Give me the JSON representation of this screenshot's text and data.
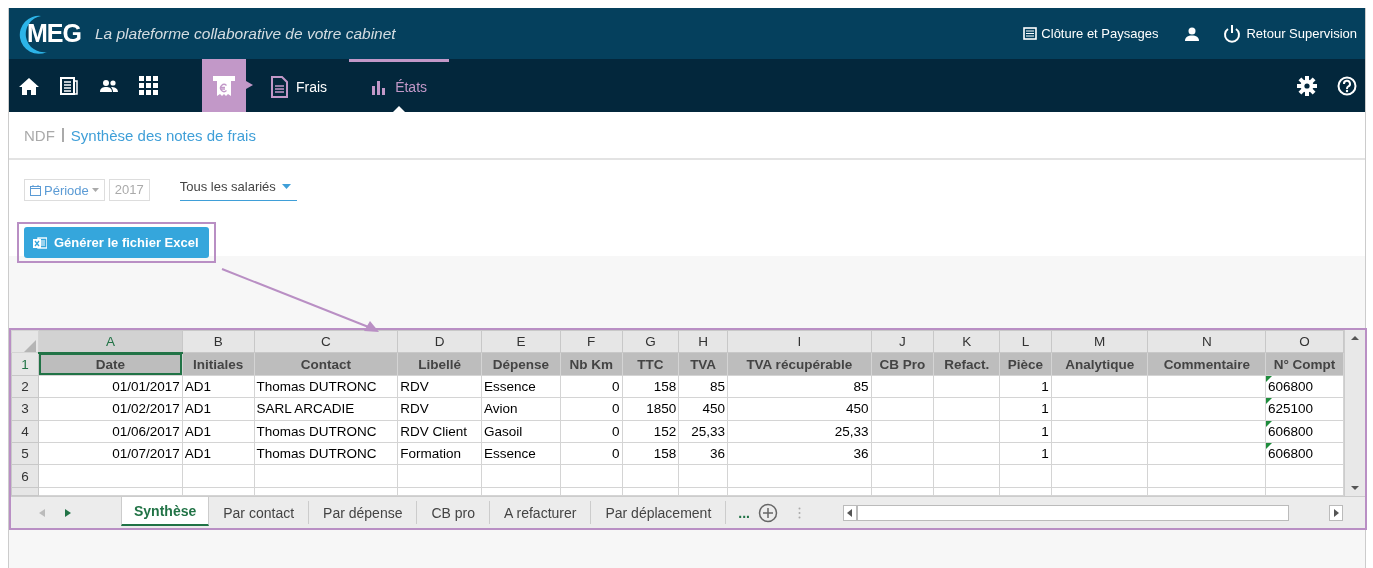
{
  "header": {
    "logo": "MEG",
    "tagline": "La plateforme collaborative de votre cabinet",
    "company": "Clôture et Paysages",
    "logout": "Retour Supervision"
  },
  "nav": {
    "module": {
      "selected": true
    },
    "tabs": [
      {
        "label": "Frais",
        "selected": false
      },
      {
        "label": "États",
        "selected": true
      }
    ]
  },
  "breadcrumb": {
    "root": "NDF",
    "title": "Synthèse des notes de frais"
  },
  "filters": {
    "period": {
      "label": "Période",
      "value": "2017"
    },
    "employee": "Tous les salariés"
  },
  "export_button": {
    "label": "Générer le fichier Excel",
    "highlighted": true
  },
  "spreadsheet": {
    "columns": [
      {
        "letter": "A",
        "header": "Date",
        "kind": "date",
        "selected": true
      },
      {
        "letter": "B",
        "header": "Initiales",
        "kind": "text",
        "selected": false
      },
      {
        "letter": "C",
        "header": "Contact",
        "kind": "text",
        "selected": false
      },
      {
        "letter": "D",
        "header": "Libellé",
        "kind": "text",
        "selected": false
      },
      {
        "letter": "E",
        "header": "Dépense",
        "kind": "text",
        "selected": false
      },
      {
        "letter": "F",
        "header": "Nb Km",
        "kind": "number",
        "selected": false
      },
      {
        "letter": "G",
        "header": "TTC",
        "kind": "number",
        "selected": false
      },
      {
        "letter": "H",
        "header": "TVA",
        "kind": "number",
        "selected": false
      },
      {
        "letter": "I",
        "header": "TVA récupérable",
        "kind": "number",
        "selected": false
      },
      {
        "letter": "J",
        "header": "CB Pro",
        "kind": "text",
        "selected": false
      },
      {
        "letter": "K",
        "header": "Refact.",
        "kind": "text",
        "selected": false
      },
      {
        "letter": "L",
        "header": "Pièce",
        "kind": "number",
        "selected": false
      },
      {
        "letter": "M",
        "header": "Analytique",
        "kind": "text",
        "selected": false
      },
      {
        "letter": "N",
        "header": "Commentaire",
        "kind": "text",
        "selected": false
      },
      {
        "letter": "O",
        "header": "N° Compt",
        "kind": "text_number",
        "selected": false
      }
    ],
    "header_row": "1",
    "rows": [
      {
        "number": "2",
        "cells": [
          "01/01/2017",
          "AD1",
          "Thomas DUTRONC",
          "RDV",
          "Essence",
          "0",
          "158",
          "85",
          "85",
          null,
          null,
          "1",
          null,
          null,
          "606800"
        ]
      },
      {
        "number": "3",
        "cells": [
          "01/02/2017",
          "AD1",
          "SARL ARCADIE",
          "RDV",
          "Avion",
          "0",
          "1850",
          "450",
          "450",
          null,
          null,
          "1",
          null,
          null,
          "625100"
        ]
      },
      {
        "number": "4",
        "cells": [
          "01/06/2017",
          "AD1",
          "Thomas DUTRONC",
          "RDV Client",
          "Gasoil",
          "0",
          "152",
          "25,33",
          "25,33",
          null,
          null,
          "1",
          null,
          null,
          "606800"
        ]
      },
      {
        "number": "5",
        "cells": [
          "01/07/2017",
          "AD1",
          "Thomas DUTRONC",
          "Formation",
          "Essence",
          "0",
          "158",
          "36",
          "36",
          null,
          null,
          "1",
          null,
          null,
          "606800"
        ]
      },
      {
        "number": "6"
      }
    ],
    "sheets": [
      {
        "label": "Synthèse",
        "selected": true
      },
      {
        "label": "Par contact",
        "selected": false
      },
      {
        "label": "Par dépense",
        "selected": false
      },
      {
        "label": "CB pro",
        "selected": false
      },
      {
        "label": "A refacturer",
        "selected": false
      },
      {
        "label": "Par déplacement",
        "selected": false
      }
    ],
    "more_sheets": "..."
  }
}
